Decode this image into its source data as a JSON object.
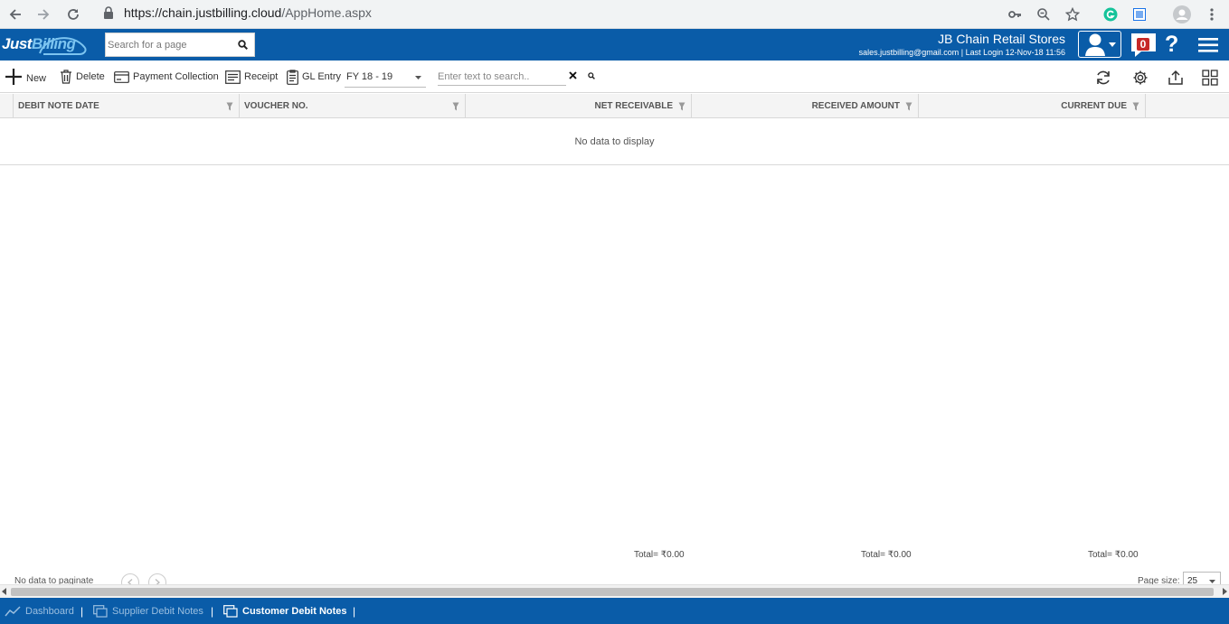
{
  "browser": {
    "url_host": "https://chain.justbilling.cloud",
    "url_path": "/AppHome.aspx"
  },
  "header": {
    "logo_part1": "Just",
    "logo_part2": "Billing",
    "search_placeholder": "Search for a page",
    "store_name": "JB Chain Retail Stores",
    "login_info": "sales.justbilling@gmail.com | Last Login 12-Nov-18 11:56",
    "notification_count": "0",
    "help_label": "?"
  },
  "toolbar": {
    "new_label": "New",
    "delete_label": "Delete",
    "payment_collection_label": "Payment Collection",
    "receipt_label": "Receipt",
    "gl_entry_label": "GL Entry",
    "fiscal_year": "FY 18 - 19",
    "search_placeholder": "Enter text to search..",
    "clear_label": "✖"
  },
  "grid": {
    "columns": [
      "DEBIT NOTE DATE",
      "VOUCHER NO.",
      "NET RECEIVABLE",
      "RECEIVED AMOUNT",
      "CURRENT DUE"
    ],
    "empty_message": "No data to display",
    "totals": [
      "Total= ₹0.00",
      "Total= ₹0.00",
      "Total= ₹0.00"
    ],
    "pager_text": "No data to paginate",
    "page_size_label": "Page size:",
    "page_size_value": "25"
  },
  "footer": {
    "tabs": [
      "Dashboard",
      "Supplier Debit Notes",
      "Customer Debit Notes"
    ],
    "separator": "|"
  },
  "colors": {
    "brand_blue": "#0a5ca8",
    "logo_accent": "#7cc4f0",
    "badge_red": "#c62828"
  }
}
